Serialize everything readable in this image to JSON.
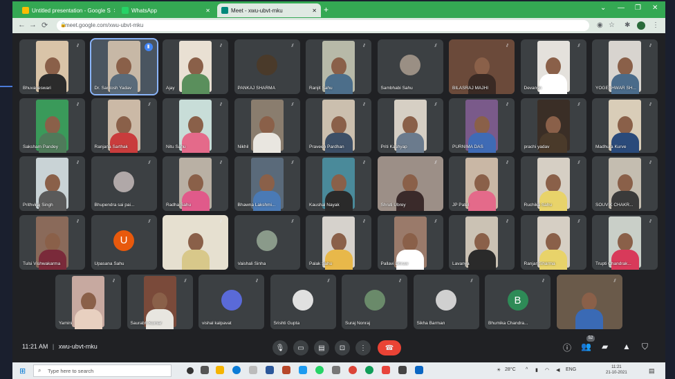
{
  "tabs": [
    {
      "label": "Untitled presentation - Google S"
    },
    {
      "label": "WhatsApp"
    },
    {
      "label": "Meet - xwu-ubvt-mku"
    }
  ],
  "url": "meet.google.com/xwu-ubvt-mku",
  "participants": [
    {
      "name": "Bhuvaneswari",
      "kind": "video",
      "bg": "#d9c4a8",
      "shirt": "#2b2b2b"
    },
    {
      "name": "Dr. Santosh Yadav",
      "kind": "video",
      "bg": "#c7b8a6",
      "shirt": "#5a6b7a",
      "highlight": true
    },
    {
      "name": "Ajay",
      "kind": "video",
      "bg": "#e9e0d3",
      "shirt": "#5a8f5c"
    },
    {
      "name": "PANKAJ SHARMA",
      "kind": "avatar",
      "avatar_bg": "#4a3a2a",
      "initial": ""
    },
    {
      "name": "Ranjit Sahu",
      "kind": "video",
      "bg": "#b7b9a8",
      "shirt": "#4c6e8a"
    },
    {
      "name": "Sambhabi Sahu",
      "kind": "avatar",
      "avatar_bg": "#9a8f84",
      "initial": ""
    },
    {
      "name": "BILASRAJ MAJHI",
      "kind": "video",
      "bg": "#6b4a3a",
      "shirt": "#3a2a24",
      "wide": true
    },
    {
      "name": "Devansh",
      "kind": "video",
      "bg": "#e4e1dc",
      "shirt": "#ffffff"
    },
    {
      "name": "YOGESHWAR SH...",
      "kind": "video",
      "bg": "#d8d4cf",
      "shirt": "#4a6b8a"
    },
    {
      "name": "Saksham Pandey",
      "kind": "video",
      "bg": "#3a9a5a",
      "shirt": "#4f7a5a"
    },
    {
      "name": "Ranjana Sarthak",
      "kind": "video",
      "bg": "#cbb9a6",
      "shirt": "#c93c3c"
    },
    {
      "name": "Nitu Sahu",
      "kind": "video",
      "bg": "#c8ddd8",
      "shirt": "#e46a8a"
    },
    {
      "name": "Nikhil",
      "kind": "video",
      "bg": "#8a7d6e",
      "shirt": "#e9e6e0"
    },
    {
      "name": "Praveen Pardhan",
      "kind": "video",
      "bg": "#cbbfae",
      "shirt": "#3d4f66"
    },
    {
      "name": "Priti Kashyap",
      "kind": "video",
      "bg": "#d6cfc4",
      "shirt": "#6b7b8d"
    },
    {
      "name": "PURNIMA DAS",
      "kind": "video",
      "bg": "#7a5a8a",
      "shirt": "#3f6bb5"
    },
    {
      "name": "prachi yadav",
      "kind": "video",
      "bg": "#3a2e26",
      "shirt": "#4a3a2a"
    },
    {
      "name": "Madhura Kurve",
      "kind": "video",
      "bg": "#d9cdb8",
      "shirt": "#2a4a7a"
    },
    {
      "name": "Prithviraj Singh",
      "kind": "video",
      "bg": "#c9d3d6",
      "shirt": "#5a5a5a"
    },
    {
      "name": "Bhupendra sai pai...",
      "kind": "avatar",
      "avatar_bg": "#b0a8a8",
      "initial": ""
    },
    {
      "name": "Radha Sahu",
      "kind": "video",
      "bg": "#b9b0a4",
      "shirt": "#e05a8a"
    },
    {
      "name": "Bhawna Lakshmi...",
      "kind": "video",
      "bg": "#5a6a7a",
      "shirt": "#4a7ab5"
    },
    {
      "name": "Kaushal Nayak",
      "kind": "video",
      "bg": "#4a8a9a",
      "shirt": "#2a2a2a"
    },
    {
      "name": "Shruti Ubrey",
      "kind": "video",
      "bg": "#9c8f87",
      "shirt": "#3a2a2a",
      "wide": true
    },
    {
      "name": "JP Patel",
      "kind": "video",
      "bg": "#c9b7a5",
      "shirt": "#e46a8a"
    },
    {
      "name": "Ruchika Sahu",
      "kind": "video",
      "bg": "#d6cfc4",
      "shirt": "#e8d36a"
    },
    {
      "name": "SOUVIK CHAKR...",
      "kind": "video",
      "bg": "#c4bdb0",
      "shirt": "#3a3a3a"
    },
    {
      "name": "Tulsi Vishwakarma",
      "kind": "video",
      "bg": "#8a6a5a",
      "shirt": "#7a2a3a"
    },
    {
      "name": "Upasana Sahu",
      "kind": "avatar",
      "avatar_bg": "#e8590c",
      "initial": "U"
    },
    {
      "name": "",
      "kind": "video",
      "bg": "#e6e0d0",
      "shirt": "#d8c88a",
      "wide": true
    },
    {
      "name": "Vaishali Sinha",
      "kind": "avatar",
      "avatar_bg": "#8a9a8a",
      "initial": ""
    },
    {
      "name": "Palak Sahu",
      "kind": "video",
      "bg": "#d6d2cc",
      "shirt": "#e8b84a"
    },
    {
      "name": "Pallavi Dhruw",
      "kind": "video",
      "bg": "#9a7a6a",
      "shirt": "#ffffff"
    },
    {
      "name": "Lavanya",
      "kind": "video",
      "bg": "#cbc2b4",
      "shirt": "#2a2a2a"
    },
    {
      "name": "Ranjan Sharma",
      "kind": "video",
      "bg": "#d6cfc4",
      "shirt": "#e8d36a"
    },
    {
      "name": "Trupti Chandrak...",
      "kind": "video",
      "bg": "#c9cfc8",
      "shirt": "#d83a5a"
    }
  ],
  "bottom_row": [
    {
      "name": "Yamini",
      "kind": "video",
      "bg": "#c7a9a0",
      "shirt": "#e8d0c0"
    },
    {
      "name": "Saurabh Kumar",
      "kind": "video",
      "bg": "#7a4a3a",
      "shirt": "#e8e6e0"
    },
    {
      "name": "vishal kalpavat",
      "kind": "avatar",
      "avatar_bg": "#5a6ad8",
      "initial": ""
    },
    {
      "name": "Srishti Gupta",
      "kind": "avatar",
      "avatar_bg": "#e0e0e0",
      "initial": ""
    },
    {
      "name": "Suraj Nonraj",
      "kind": "avatar",
      "avatar_bg": "#6a8a6a",
      "initial": ""
    },
    {
      "name": "Sikha Barman",
      "kind": "avatar",
      "avatar_bg": "#d0d0d0",
      "initial": ""
    },
    {
      "name": "Bhumika Chandra...",
      "kind": "avatar",
      "avatar_bg": "#2e8b57",
      "initial": "B"
    },
    {
      "name": "",
      "kind": "video",
      "bg": "#6a5a4a",
      "shirt": "#3a6ab5",
      "wide": true
    }
  ],
  "meeting": {
    "time": "11:21 AM",
    "code": "xwu-ubvt-mku",
    "participant_count": "52"
  },
  "taskbar": {
    "search_placeholder": "Type here to search",
    "weather": "28°C",
    "lang": "ENG",
    "clock_time": "11:21",
    "clock_date": "21-10-2021"
  },
  "colors": {
    "tab_bar": "#34a853",
    "meet_bg": "#202124",
    "tile_bg": "#3c4043",
    "end_call": "#ea4335",
    "active_speaker": "#8ab4f8"
  }
}
